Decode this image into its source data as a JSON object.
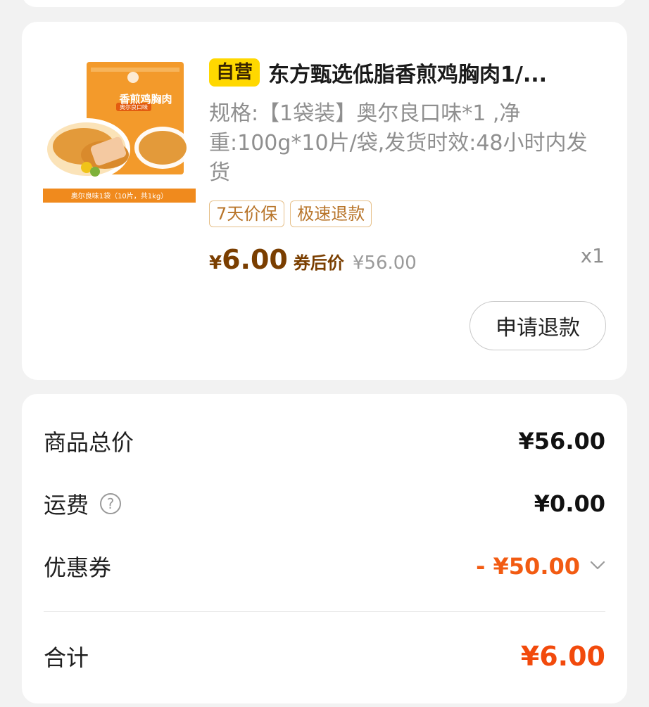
{
  "product": {
    "self_badge": "自营",
    "title": "东方甄选低脂香煎鸡胸肉1/...",
    "spec": "规格:【1袋装】奥尔良口味*1 ,净重:100g*10片/袋,发货时效:48小时内发货",
    "image": {
      "package_title": "香煎鸡胸肉",
      "package_sub": "奥尔良口味",
      "banner": "奥尔良味1袋（10片，共1kg）"
    },
    "tags": [
      "7天价保",
      "极速退款"
    ],
    "price_currency": "¥",
    "price_value": "6.00",
    "price_label": "券后价",
    "original_price": "¥56.00",
    "quantity": "x1",
    "refund_button": "申请退款"
  },
  "summary": {
    "goods_total_label": "商品总价",
    "goods_total_value": "¥56.00",
    "shipping_label": "运费",
    "shipping_value": "¥0.00",
    "coupon_label": "优惠券",
    "coupon_value": "- ¥50.00",
    "total_label": "合计",
    "total_value": "¥6.00"
  },
  "colors": {
    "accent_orange": "#f25b12",
    "price_brown": "#7a3e00",
    "badge_yellow": "#ffd800",
    "tag_border": "#e6c089"
  },
  "icons": [
    "help-circle-icon",
    "chevron-down-icon"
  ]
}
